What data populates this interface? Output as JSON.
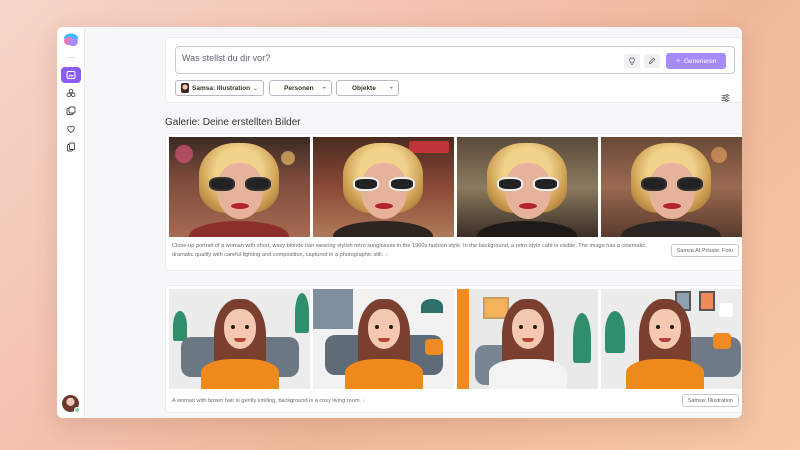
{
  "prompt": {
    "placeholder": "Was stellst du dir vor?",
    "generate_label": "Generieren"
  },
  "chips": [
    {
      "label": "Samsa: Illustration",
      "suffix": "⌄"
    },
    {
      "label": "Personen",
      "suffix": "+"
    },
    {
      "label": "Objekte",
      "suffix": "+"
    }
  ],
  "gallery": {
    "title": "Galerie: Deine erstellten Bilder",
    "cards": [
      {
        "description": "Close-up portrait of a woman with short, wavy blonde hair wearing stylish retro sunglasses in the 1960s fashion style. In the background, a retro-style café is visible. The image has a cinematic, dramatic quality with careful lighting and composition, captured in a photographic still.",
        "more_icon": "↓",
        "tag": "Samsa AI Private: Foto",
        "image_names": [
          "retro-portrait-1",
          "retro-portrait-2",
          "retro-portrait-3",
          "retro-portrait-4"
        ]
      },
      {
        "description": "A woman with brown hair is gently smiling, background is a cosy living room.",
        "more_icon": "↓",
        "tag": "Samsa: Illustration",
        "image_names": [
          "illustration-1",
          "illustration-2",
          "illustration-3",
          "illustration-4"
        ]
      }
    ]
  },
  "colors": {
    "accent": "#8b5cf6",
    "generate_button": "#a78bfa"
  },
  "icons": {
    "logo": "samsa-logo-icon",
    "nav": [
      "image-gen-icon",
      "people-icon",
      "gallery-icon",
      "heart-icon",
      "copy-icon"
    ],
    "prompt_tools": [
      "lightbulb-icon",
      "pencil-icon",
      "sparkle-icon"
    ],
    "settings": "sliders-icon"
  }
}
